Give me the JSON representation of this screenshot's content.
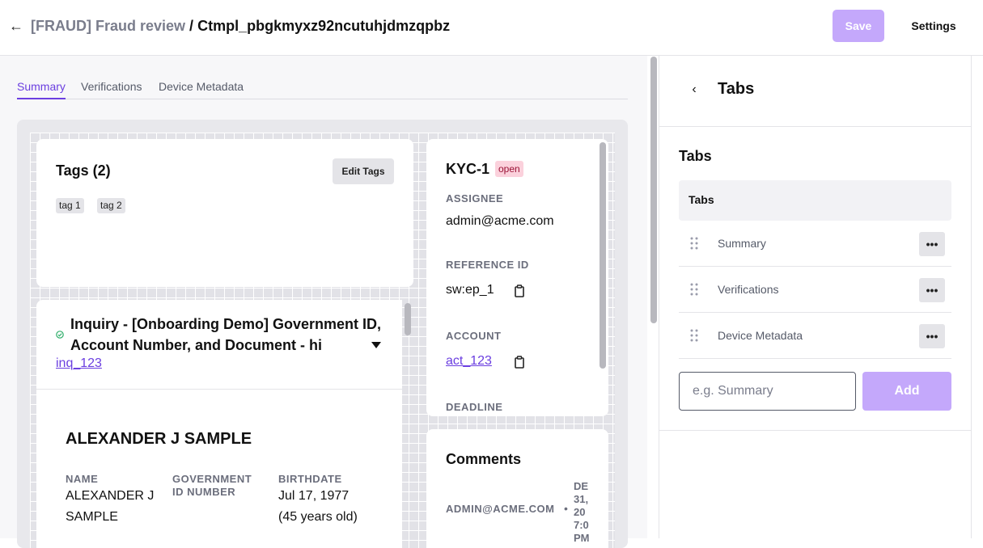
{
  "header": {
    "back_icon": "arrow-left-icon",
    "breadcrumb_parent": "[FRAUD] Fraud review",
    "breadcrumb_separator": "/",
    "breadcrumb_current": "Ctmpl_pbgkmyxz92ncutuhjdmzqpbz",
    "save_label": "Save",
    "settings_label": "Settings"
  },
  "tabs": [
    {
      "label": "Summary",
      "active": true
    },
    {
      "label": "Verifications",
      "active": false
    },
    {
      "label": "Device Metadata",
      "active": false
    }
  ],
  "tags_card": {
    "title": "Tags (2)",
    "edit_label": "Edit Tags",
    "tags": [
      "tag 1",
      "tag 2"
    ]
  },
  "kyc_card": {
    "title": "KYC-1",
    "status": "open",
    "assignee_label": "ASSIGNEE",
    "assignee_value": "admin@acme.com",
    "reference_label": "REFERENCE ID",
    "reference_value": "sw:ep_1",
    "account_label": "ACCOUNT",
    "account_value": "act_123",
    "deadline_label": "DEADLINE"
  },
  "inquiry_card": {
    "title": "Inquiry - [Onboarding Demo] Government ID, Account Number, and Document - hi",
    "link": "inq_123",
    "person_name": "ALEXANDER J SAMPLE",
    "name_label": "NAME",
    "name_value_1": "ALEXANDER J",
    "name_value_2": "SAMPLE",
    "govid_label_1": "GOVERNMENT",
    "govid_label_2": "ID NUMBER",
    "birthdate_label": "BIRTHDATE",
    "birthdate_value": "Jul 17, 1977",
    "age_value": "(45 years old)"
  },
  "comments_card": {
    "title": "Comments",
    "author": "ADMIN@ACME.COM",
    "separator": "•",
    "date_lines": [
      "DE",
      "31,",
      "20",
      "7:0",
      "PM"
    ]
  },
  "right_panel": {
    "back_icon": "chevron-left-icon",
    "header_title": "Tabs",
    "section_title": "Tabs",
    "table_header": "Tabs",
    "rows": [
      "Summary",
      "Verifications",
      "Device Metadata"
    ],
    "more_label": "•••",
    "input_placeholder": "e.g. Summary",
    "add_label": "Add"
  },
  "colors": {
    "accent": "#6b3fe0",
    "button_disabled": "#c4a8fb",
    "badge_bg": "#fbd1dc"
  }
}
